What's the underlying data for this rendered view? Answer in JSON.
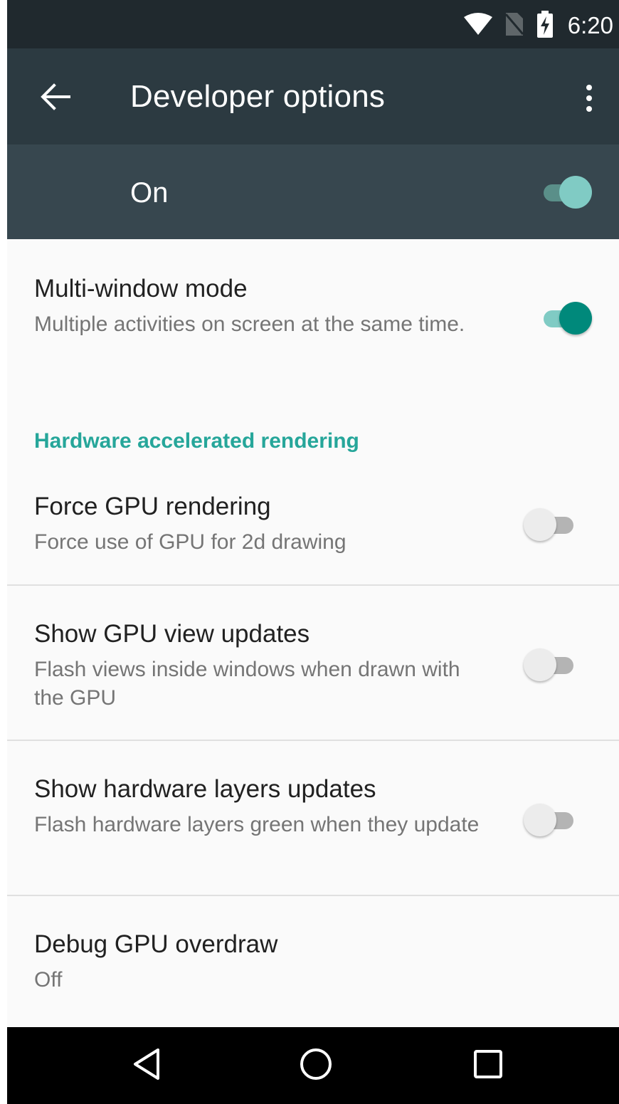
{
  "status_bar": {
    "time": "6:20",
    "icons": [
      "wifi-icon",
      "no-sim-icon",
      "battery-charging-icon"
    ]
  },
  "toolbar": {
    "title": "Developer options",
    "back_icon": "arrow-back-icon",
    "overflow_icon": "more-vert-icon"
  },
  "master": {
    "label": "On",
    "enabled": true
  },
  "items": [
    {
      "title": "Multi-window mode",
      "summary": "Multiple activities on screen at the same time.",
      "checked": true
    },
    {
      "title": "Force GPU rendering",
      "summary": "Force use of GPU for 2d drawing",
      "checked": false
    },
    {
      "title": "Show GPU view updates",
      "summary": "Flash views inside windows when drawn with the GPU",
      "checked": false
    },
    {
      "title": "Show hardware layers updates",
      "summary": "Flash hardware layers green when they update",
      "checked": false
    },
    {
      "title": "Debug GPU overdraw",
      "summary": "Off"
    }
  ],
  "category": {
    "label": "Hardware accelerated rendering"
  },
  "nav_bar": {
    "buttons": [
      "back-triangle-icon",
      "home-circle-icon",
      "recents-square-icon"
    ]
  },
  "colors": {
    "status_bar": "#20292e",
    "toolbar": "#2c3a41",
    "master_bar": "#37474f",
    "accent": "#00897b",
    "category_text": "#26a69a"
  }
}
